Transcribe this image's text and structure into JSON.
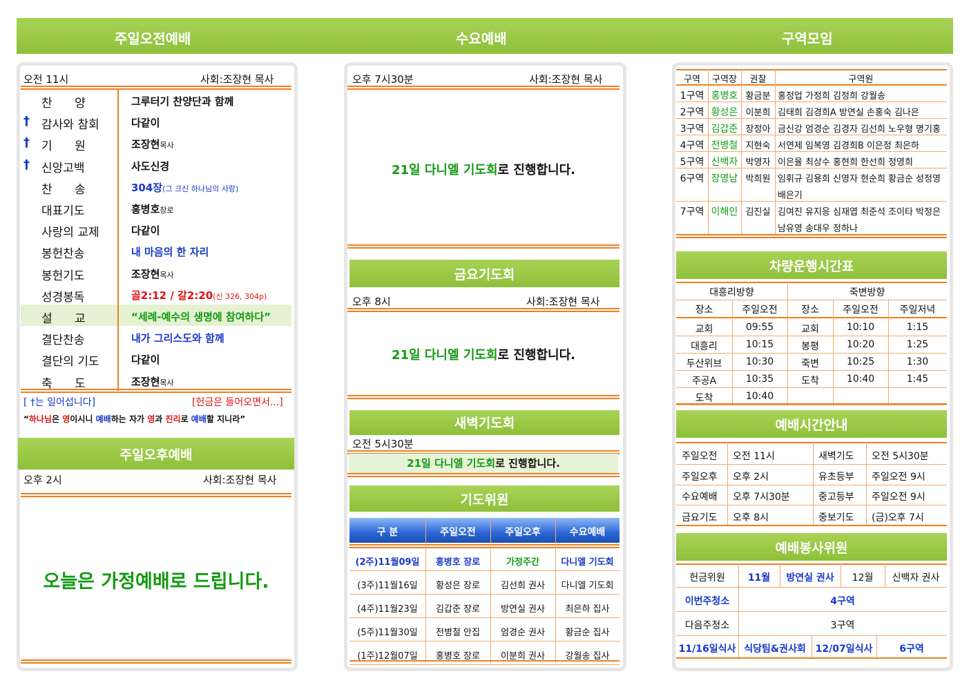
{
  "headers": {
    "sun_am": "주일오전예배",
    "wed": "수요예배",
    "district": "구역모임"
  },
  "sun_am": {
    "time": "오전 11시",
    "leader": "사회:조장현 목사",
    "items": [
      {
        "cross": "",
        "name": "찬      양",
        "content": "그루터기 찬양단과 함께",
        "extra": "",
        "color": "black"
      },
      {
        "cross": "†",
        "name": "감사와 참회",
        "content": "다같이",
        "extra": "",
        "color": "black"
      },
      {
        "cross": "†",
        "name": "기      원",
        "content": "조장현",
        "extra": "목사",
        "color": "black"
      },
      {
        "cross": "†",
        "name": "신앙고백",
        "content": "사도신경",
        "extra": "",
        "color": "black"
      },
      {
        "cross": "",
        "name": "찬      송",
        "content": "304장",
        "extra": "(그 크신 하나님의 사랑)",
        "color": "blue"
      },
      {
        "cross": "",
        "name": "대표기도",
        "content": "홍병호",
        "extra": "장로",
        "color": "black"
      },
      {
        "cross": "",
        "name": "사랑의 교제",
        "content": "다같이",
        "extra": "",
        "color": "black"
      },
      {
        "cross": "",
        "name": "봉헌찬송",
        "content": "내 마음의 한 자리",
        "extra": "",
        "color": "blue"
      },
      {
        "cross": "",
        "name": "봉헌기도",
        "content": "조장현",
        "extra": "목사",
        "color": "black"
      },
      {
        "cross": "",
        "name": "성경봉독",
        "content": "골2:12 / 갈2:20",
        "extra": "(신 326, 304p)",
        "color": "red"
      },
      {
        "cross": "",
        "name": "설      교",
        "content": "“세례-예수의 생명에 참여하다”",
        "extra": "",
        "color": "green"
      },
      {
        "cross": "",
        "name": "결단찬송",
        "content": "내가 그리스도와 함께",
        "extra": "",
        "color": "blue"
      },
      {
        "cross": "",
        "name": "결단의 기도",
        "content": "다같이",
        "extra": "",
        "color": "black"
      },
      {
        "cross": "",
        "name": "축      도",
        "content": "조장현",
        "extra": "목사",
        "color": "black"
      }
    ],
    "note_left": "[ †는 일어섭니다]",
    "note_right": "[헌금은 들어오면서...]",
    "verse": {
      "p1": "“",
      "w1": "하나님",
      "p2": "은 ",
      "w2": "영",
      "p3": "이시니 ",
      "w3": "예배",
      "p4": "하는 자가 ",
      "w4": "영",
      "p5": "과 ",
      "w5": "진리",
      "p6": "로 ",
      "w6": "예배",
      "p7": "할 지니라”"
    }
  },
  "sun_pm": {
    "title": "주일오후예배",
    "time": "오후 2시",
    "leader": "사회:조장현 목사",
    "message": "오늘은 가정예배로 드립니다."
  },
  "wed": {
    "time": "오후 7시30분",
    "leader": "사회:조장현 목사",
    "msg_green": "21일 다니엘 기도회",
    "msg_rest": "로 진행합니다."
  },
  "fri": {
    "title": "금요기도회",
    "time": "오후 8시",
    "leader": "사회:조장현 목사",
    "msg_green": "21일 다니엘 기도회",
    "msg_rest": "로 진행합니다."
  },
  "dawn": {
    "title": "새벽기도회",
    "time": "오전 5시30분",
    "msg_green": "21일 다니엘 기도회",
    "msg_rest": "로 진행합니다."
  },
  "prayer": {
    "title": "기도위원",
    "headers": [
      "구   분",
      "주일오전",
      "주일오후",
      "수요예배"
    ],
    "rows": [
      [
        "(2주)11월09일",
        "홍병호 장로",
        "가정주간",
        "다니엘 기도회"
      ],
      [
        "(3주)11월16일",
        "황성은 장로",
        "김선희 권사",
        "다니엘 기도회"
      ],
      [
        "(4주)11월23일",
        "김갑준 장로",
        "방연실 권사",
        "최은하 집사"
      ],
      [
        "(5주)11월30일",
        "전병철 안집",
        "엄경순 권사",
        "황금순 집사"
      ],
      [
        "(1주)12월07일",
        "홍병호 장로",
        "이분희 권사",
        "강월송 집사"
      ]
    ]
  },
  "district": {
    "headers": [
      "구역",
      "구역장",
      "권찰",
      "구역원"
    ],
    "rows": [
      [
        "1구역",
        "홍병호",
        "황금분",
        "홍정업 가정희 김정희 강월송",
        ""
      ],
      [
        "2구역",
        "황성은",
        "이분희",
        "김태희 김경희A 방연실 손홍숙 김나은",
        ""
      ],
      [
        "3구역",
        "김갑준",
        "장정아",
        "금신강 엄경순 김경자 김선희 노우형 명기홍",
        ""
      ],
      [
        "4구역",
        "전병철",
        "지현숙",
        "서연제 임복영 김경희B 이은정 최은하",
        ""
      ],
      [
        "5구역",
        "신백자",
        "박영자",
        "이은율 최상수 홍현희 한선희 정영희",
        ""
      ],
      [
        "6구역",
        "장영남",
        "박희원",
        "임휘규 김용희 신영자 현순희 황금순 성정영",
        "배은기"
      ],
      [
        "7구역",
        "이해인",
        "김진실",
        "김여진 유지응 심재엽 최준석 조이타 박정은",
        "남유영 송대우 정하나"
      ]
    ]
  },
  "bus": {
    "title": "차량운행시간표",
    "dir1": "대흥리방향",
    "dir2": "죽변방향",
    "sub": [
      "장소",
      "주일오전",
      "장소",
      "주일오전",
      "주일저녁"
    ],
    "rows": [
      [
        "교회",
        "09:55",
        "교회",
        "10:10",
        "1:15"
      ],
      [
        "대흥리",
        "10:15",
        "봉평",
        "10:20",
        "1:25"
      ],
      [
        "두산위브",
        "10:30",
        "죽변",
        "10:25",
        "1:30"
      ],
      [
        "주공A",
        "10:35",
        "도착",
        "10:40",
        "1:45"
      ],
      [
        "도착",
        "10:40",
        "",
        "",
        ""
      ]
    ]
  },
  "times": {
    "title": "예배시간안내",
    "rows": [
      [
        "주일오전",
        "오전 11시",
        "새벽기도",
        "오전 5시30분"
      ],
      [
        "주일오후",
        "오후 2시",
        "유초등부",
        "주일오전 9시"
      ],
      [
        "수요예배",
        "오후 7시30분",
        "중고등부",
        "주일오전 9시"
      ],
      [
        "금요기도",
        "오후 8시",
        "중보기도",
        "(금)오후 7시"
      ]
    ]
  },
  "service": {
    "title": "예배봉사위원",
    "r1": [
      "헌금위원",
      "11월",
      "방연실 권사",
      "12월",
      "신백자 권사"
    ],
    "r2": [
      "이번주청소",
      "4구역"
    ],
    "r3": [
      "다음주청소",
      "3구역"
    ],
    "r4": [
      "11/16일식사",
      "식당팀&권사회",
      "12/07일식사",
      "6구역"
    ]
  }
}
